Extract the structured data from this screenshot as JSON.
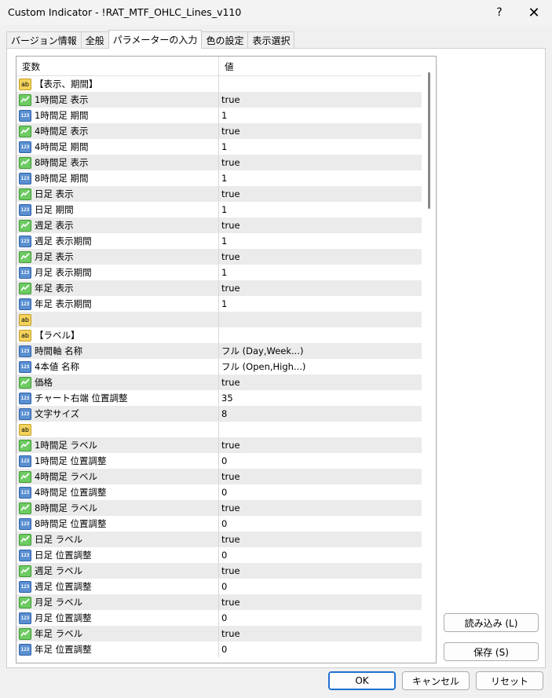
{
  "window": {
    "title": "Custom Indicator - !RAT_MTF_OHLC_Lines_v110",
    "help_label": "?",
    "close_label": "✕"
  },
  "tabs": [
    {
      "label": "バージョン情報"
    },
    {
      "label": "全般"
    },
    {
      "label": "パラメーターの入力"
    },
    {
      "label": "色の設定"
    },
    {
      "label": "表示選択"
    }
  ],
  "grid": {
    "col_variable": "変数",
    "col_value": "値",
    "rows": [
      {
        "type": "str",
        "name": "【表示、期間】",
        "value": ""
      },
      {
        "type": "bool",
        "name": "1時間足 表示",
        "value": "true"
      },
      {
        "type": "num",
        "name": "1時間足 期間",
        "value": "1"
      },
      {
        "type": "bool",
        "name": "4時間足 表示",
        "value": "true"
      },
      {
        "type": "num",
        "name": "4時間足 期間",
        "value": "1"
      },
      {
        "type": "bool",
        "name": "8時間足 表示",
        "value": "true"
      },
      {
        "type": "num",
        "name": "8時間足 期間",
        "value": "1"
      },
      {
        "type": "bool",
        "name": "日足 表示",
        "value": "true"
      },
      {
        "type": "num",
        "name": "日足 期間",
        "value": "1"
      },
      {
        "type": "bool",
        "name": "週足 表示",
        "value": "true"
      },
      {
        "type": "num",
        "name": "週足 表示期間",
        "value": "1"
      },
      {
        "type": "bool",
        "name": "月足 表示",
        "value": "true"
      },
      {
        "type": "num",
        "name": "月足 表示期間",
        "value": "1"
      },
      {
        "type": "bool",
        "name": "年足 表示",
        "value": "true"
      },
      {
        "type": "num",
        "name": "年足 表示期間",
        "value": "1"
      },
      {
        "type": "str",
        "name": "",
        "value": ""
      },
      {
        "type": "str",
        "name": "【ラベル】",
        "value": ""
      },
      {
        "type": "num",
        "name": "時間軸 名称",
        "value": "フル (Day,Week...)"
      },
      {
        "type": "num",
        "name": "4本値 名称",
        "value": "フル (Open,High...)"
      },
      {
        "type": "bool",
        "name": "価格",
        "value": "true"
      },
      {
        "type": "num",
        "name": "チャート右端 位置調整",
        "value": "35"
      },
      {
        "type": "num",
        "name": "文字サイズ",
        "value": "8"
      },
      {
        "type": "str",
        "name": "",
        "value": ""
      },
      {
        "type": "bool",
        "name": "1時間足 ラベル",
        "value": "true"
      },
      {
        "type": "num",
        "name": "1時間足 位置調整",
        "value": "0"
      },
      {
        "type": "bool",
        "name": "4時間足 ラベル",
        "value": "true"
      },
      {
        "type": "num",
        "name": "4時間足 位置調整",
        "value": "0"
      },
      {
        "type": "bool",
        "name": "8時間足 ラベル",
        "value": "true"
      },
      {
        "type": "num",
        "name": "8時間足 位置調整",
        "value": "0"
      },
      {
        "type": "bool",
        "name": "日足 ラベル",
        "value": "true"
      },
      {
        "type": "num",
        "name": "日足 位置調整",
        "value": "0"
      },
      {
        "type": "bool",
        "name": "週足 ラベル",
        "value": "true"
      },
      {
        "type": "num",
        "name": "週足 位置調整",
        "value": "0"
      },
      {
        "type": "bool",
        "name": "月足 ラベル",
        "value": "true"
      },
      {
        "type": "num",
        "name": "月足 位置調整",
        "value": "0"
      },
      {
        "type": "bool",
        "name": "年足 ラベル",
        "value": "true"
      },
      {
        "type": "num",
        "name": "年足 位置調整",
        "value": "0"
      }
    ]
  },
  "side_buttons": {
    "load_label": "読み込み (L)",
    "save_label": "保存 (S)"
  },
  "footer": {
    "ok_label": "OK",
    "cancel_label": "キャンセル",
    "reset_label": "リセット"
  },
  "icons": {
    "bool": "boolean-param-icon",
    "num": "numeric-param-icon",
    "str": "string-param-icon"
  },
  "colors": {
    "accent": "#1f6fd1",
    "row_alt": "#ebebeb"
  }
}
